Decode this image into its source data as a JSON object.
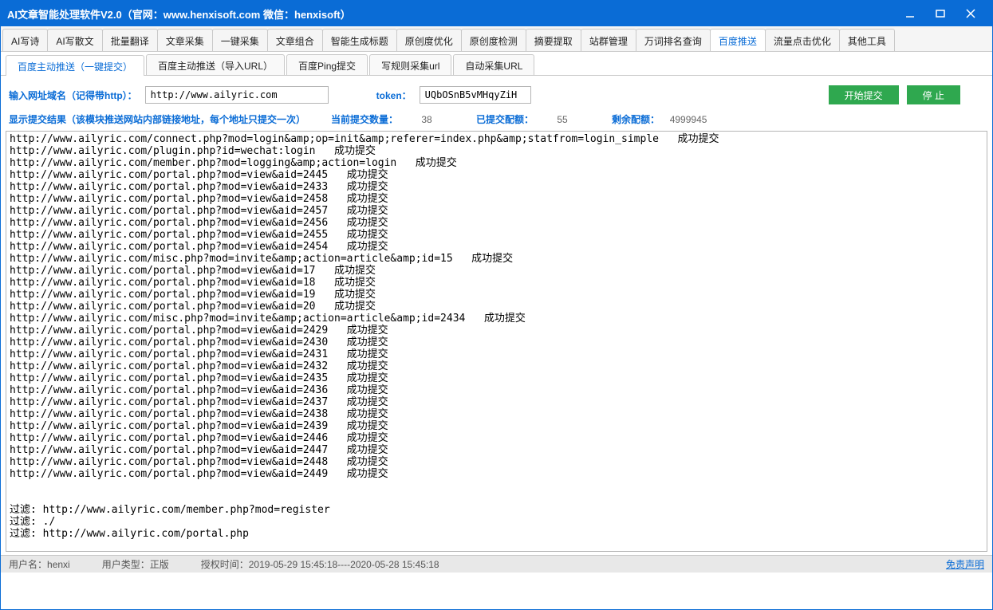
{
  "title": "AI文章智能处理软件V2.0（官网：www.henxisoft.com  微信：henxisoft）",
  "maintabs": [
    "AI写诗",
    "AI写散文",
    "批量翻译",
    "文章采集",
    "一键采集",
    "文章组合",
    "智能生成标题",
    "原创度优化",
    "原创度检测",
    "摘要提取",
    "站群管理",
    "万词排名查询",
    "百度推送",
    "流量点击优化",
    "其他工具"
  ],
  "maintab_active": 12,
  "subtabs": [
    "百度主动推送（一键提交）",
    "百度主动推送（导入URL）",
    "百度Ping提交",
    "写规则采集url",
    "自动采集URL"
  ],
  "subtab_active": 0,
  "form": {
    "url_label": "输入网址域名（记得带http）：",
    "url_value": "http://www.ailyric.com",
    "token_label": "token：",
    "token_value": "UQbOSnB5vMHqyZiH",
    "btn_start": "开始提交",
    "btn_stop": "停  止"
  },
  "stats": {
    "result_label": "显示提交结果（该模块推送网站内部链接地址，每个地址只提交一次）",
    "current_label": "当前提交数量：",
    "current_value": "38",
    "submitted_label": "已提交配额：",
    "submitted_value": "55",
    "remain_label": "剩余配额：",
    "remain_value": "4999945"
  },
  "log_lines": [
    "http://www.ailyric.com/connect.php?mod=login&amp;op=init&amp;referer=index.php&amp;statfrom=login_simple   成功提交",
    "http://www.ailyric.com/plugin.php?id=wechat:login   成功提交",
    "http://www.ailyric.com/member.php?mod=logging&amp;action=login   成功提交",
    "http://www.ailyric.com/portal.php?mod=view&aid=2445   成功提交",
    "http://www.ailyric.com/portal.php?mod=view&aid=2433   成功提交",
    "http://www.ailyric.com/portal.php?mod=view&aid=2458   成功提交",
    "http://www.ailyric.com/portal.php?mod=view&aid=2457   成功提交",
    "http://www.ailyric.com/portal.php?mod=view&aid=2456   成功提交",
    "http://www.ailyric.com/portal.php?mod=view&aid=2455   成功提交",
    "http://www.ailyric.com/portal.php?mod=view&aid=2454   成功提交",
    "http://www.ailyric.com/misc.php?mod=invite&amp;action=article&amp;id=15   成功提交",
    "http://www.ailyric.com/portal.php?mod=view&aid=17   成功提交",
    "http://www.ailyric.com/portal.php?mod=view&aid=18   成功提交",
    "http://www.ailyric.com/portal.php?mod=view&aid=19   成功提交",
    "http://www.ailyric.com/portal.php?mod=view&aid=20   成功提交",
    "http://www.ailyric.com/misc.php?mod=invite&amp;action=article&amp;id=2434   成功提交",
    "http://www.ailyric.com/portal.php?mod=view&aid=2429   成功提交",
    "http://www.ailyric.com/portal.php?mod=view&aid=2430   成功提交",
    "http://www.ailyric.com/portal.php?mod=view&aid=2431   成功提交",
    "http://www.ailyric.com/portal.php?mod=view&aid=2432   成功提交",
    "http://www.ailyric.com/portal.php?mod=view&aid=2435   成功提交",
    "http://www.ailyric.com/portal.php?mod=view&aid=2436   成功提交",
    "http://www.ailyric.com/portal.php?mod=view&aid=2437   成功提交",
    "http://www.ailyric.com/portal.php?mod=view&aid=2438   成功提交",
    "http://www.ailyric.com/portal.php?mod=view&aid=2439   成功提交",
    "http://www.ailyric.com/portal.php?mod=view&aid=2446   成功提交",
    "http://www.ailyric.com/portal.php?mod=view&aid=2447   成功提交",
    "http://www.ailyric.com/portal.php?mod=view&aid=2448   成功提交",
    "http://www.ailyric.com/portal.php?mod=view&aid=2449   成功提交",
    "",
    "",
    "过滤: http://www.ailyric.com/member.php?mod=register",
    "过滤: ./",
    "过滤: http://www.ailyric.com/portal.php"
  ],
  "status": {
    "user_label": "用户名：",
    "user_value": "henxi",
    "type_label": "用户类型：",
    "type_value": "正版",
    "auth_label": "授权时间：",
    "auth_value": "2019-05-29 15:45:18----2020-05-28 15:45:18",
    "license_link": "免责声明"
  }
}
